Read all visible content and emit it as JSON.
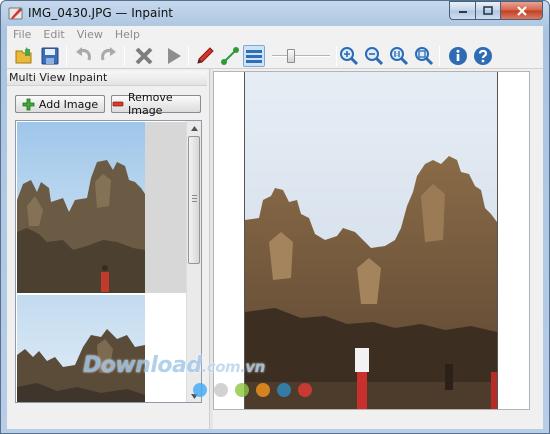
{
  "window": {
    "title": "IMG_0430.JPG — Inpaint"
  },
  "menu": {
    "items": [
      {
        "label": "File"
      },
      {
        "label": "Edit"
      },
      {
        "label": "View"
      },
      {
        "label": "Help"
      }
    ]
  },
  "toolbar": {
    "tools": [
      {
        "name": "open-icon",
        "enabled": true
      },
      {
        "name": "save-icon",
        "enabled": true
      },
      {
        "name": "undo-icon",
        "enabled": false
      },
      {
        "name": "redo-icon",
        "enabled": false
      },
      {
        "name": "delete-icon",
        "enabled": true
      },
      {
        "name": "play-icon",
        "enabled": true
      },
      {
        "name": "marker-pen-icon",
        "enabled": true
      },
      {
        "name": "line-tool-icon",
        "enabled": true
      },
      {
        "name": "layers-icon",
        "enabled": true,
        "active": true
      },
      {
        "name": "zoom-in-icon",
        "enabled": true
      },
      {
        "name": "zoom-out-icon",
        "enabled": true
      },
      {
        "name": "zoom-actual-icon",
        "enabled": true
      },
      {
        "name": "zoom-fit-icon",
        "enabled": true
      },
      {
        "name": "info-icon",
        "enabled": true
      },
      {
        "name": "help-icon",
        "enabled": true
      }
    ],
    "marker_size_level": 0.3
  },
  "panel": {
    "title": "Multi View Inpaint",
    "add_label": "Add Image",
    "remove_label": "Remove Image",
    "thumbnails": [
      {
        "selected": true
      },
      {
        "selected": false
      }
    ]
  },
  "watermark": {
    "main": "Download",
    "suffix": ".com.vn"
  },
  "colors": {
    "accent": "#3c7fc4",
    "selection": "#d7d7d7",
    "watermark_dots": [
      "#3fa9f5",
      "#c7c7c7",
      "#8cc63f",
      "#f7931e",
      "#2e8bc6",
      "#e53935"
    ]
  }
}
